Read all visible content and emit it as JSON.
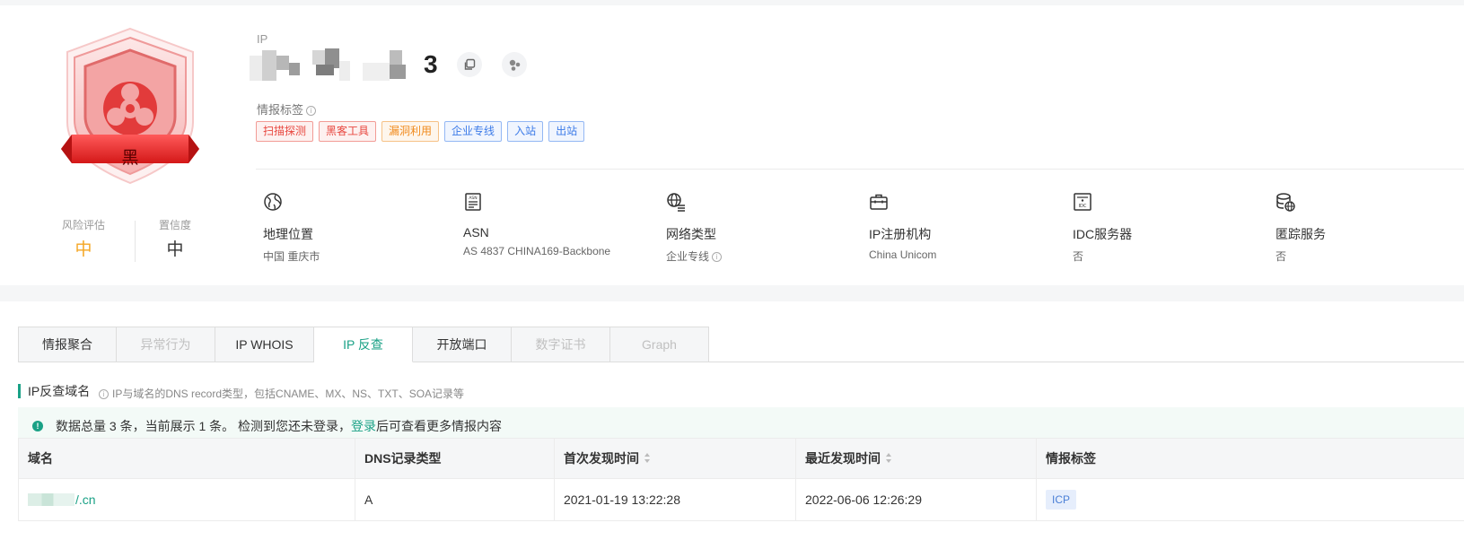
{
  "badge": {
    "verdict": "黑"
  },
  "scores": [
    {
      "label": "风险评估",
      "value": "中",
      "color": "#f5a623"
    },
    {
      "label": "置信度",
      "value": "中",
      "color": "#333333"
    }
  ],
  "ip": {
    "label": "IP",
    "visible_suffix": "3"
  },
  "tags": {
    "label": "情报标签",
    "items": [
      {
        "text": "扫描探测",
        "style": "red"
      },
      {
        "text": "黑客工具",
        "style": "red"
      },
      {
        "text": "漏洞利用",
        "style": "orange"
      },
      {
        "text": "企业专线",
        "style": "blue"
      },
      {
        "text": "入站",
        "style": "blue"
      },
      {
        "text": "出站",
        "style": "blue"
      }
    ]
  },
  "info": [
    {
      "icon": "globe-icon",
      "title": "地理位置",
      "value": "中国 重庆市"
    },
    {
      "icon": "asn-document-icon",
      "title": "ASN",
      "value": "AS 4837 CHINA169-Backbone"
    },
    {
      "icon": "network-globe-icon",
      "title": "网络类型",
      "value": "企业专线"
    },
    {
      "icon": "briefcase-icon",
      "title": "IP注册机构",
      "value": "China Unicom"
    },
    {
      "icon": "idc-server-icon",
      "title": "IDC服务器",
      "value": "否"
    },
    {
      "icon": "database-globe-icon",
      "title": "匿踪服务",
      "value": "否"
    }
  ],
  "tabs": [
    {
      "label": "情报聚合",
      "state": "normal"
    },
    {
      "label": "异常行为",
      "state": "disabled"
    },
    {
      "label": "IP WHOIS",
      "state": "normal"
    },
    {
      "label": "IP 反查",
      "state": "active"
    },
    {
      "label": "开放端口",
      "state": "normal"
    },
    {
      "label": "数字证书",
      "state": "disabled"
    },
    {
      "label": "Graph",
      "state": "disabled"
    }
  ],
  "section": {
    "title": "IP反查域名",
    "hint": "IP与域名的DNS record类型，包括CNAME、MX、NS、TXT、SOA记录等"
  },
  "notice": {
    "text1": "数据总量 3 条，当前展示 1 条。 检测到您还未登录，",
    "login": "登录",
    "text2": "后可查看更多情报内容"
  },
  "table": {
    "headers": [
      "域名",
      "DNS记录类型",
      "首次发现时间",
      "最近发现时间",
      "情报标签"
    ],
    "rows": [
      {
        "domain_suffix": "/.cn",
        "type": "A",
        "first": "2021-01-19 13:22:28",
        "last": "2022-06-06 12:26:29",
        "tag": "ICP"
      }
    ]
  },
  "colors": {
    "accent": "#1aa186",
    "danger": "#e8473f",
    "warning": "#f5a623"
  }
}
